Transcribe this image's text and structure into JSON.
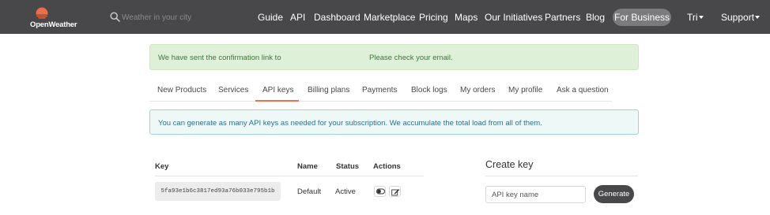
{
  "brand": {
    "name": "OpenWeather",
    "sun_color": "#eb6e4b",
    "header_color": "#48484a"
  },
  "search": {
    "placeholder": "Weather in your city"
  },
  "nav": {
    "items": [
      "Guide",
      "API",
      "Dashboard",
      "Marketplace",
      "Pricing",
      "Maps",
      "Our Initiatives",
      "Partners",
      "Blog"
    ],
    "business": "For Business",
    "user": "Tri",
    "support": "Support"
  },
  "alert_success": {
    "text_before": "We have sent the confirmation link to",
    "text_after": "Please check your email."
  },
  "tabs": {
    "items": [
      "New Products",
      "Services",
      "API keys",
      "Billing plans",
      "Payments",
      "Block logs",
      "My orders",
      "My profile",
      "Ask a question"
    ],
    "active": "API keys"
  },
  "alert_info": {
    "text": "You can generate as many API keys as needed for your subscription. We accumulate the total load from all of them."
  },
  "keys_table": {
    "headers": {
      "key": "Key",
      "name": "Name",
      "status": "Status",
      "actions": "Actions"
    },
    "rows": [
      {
        "key": "5fa93e1b6c3817ed93a76b033e795b1b",
        "name": "Default",
        "status": "Active"
      }
    ]
  },
  "create_key": {
    "title": "Create key",
    "input_placeholder": "API key name",
    "button": "Generate"
  }
}
